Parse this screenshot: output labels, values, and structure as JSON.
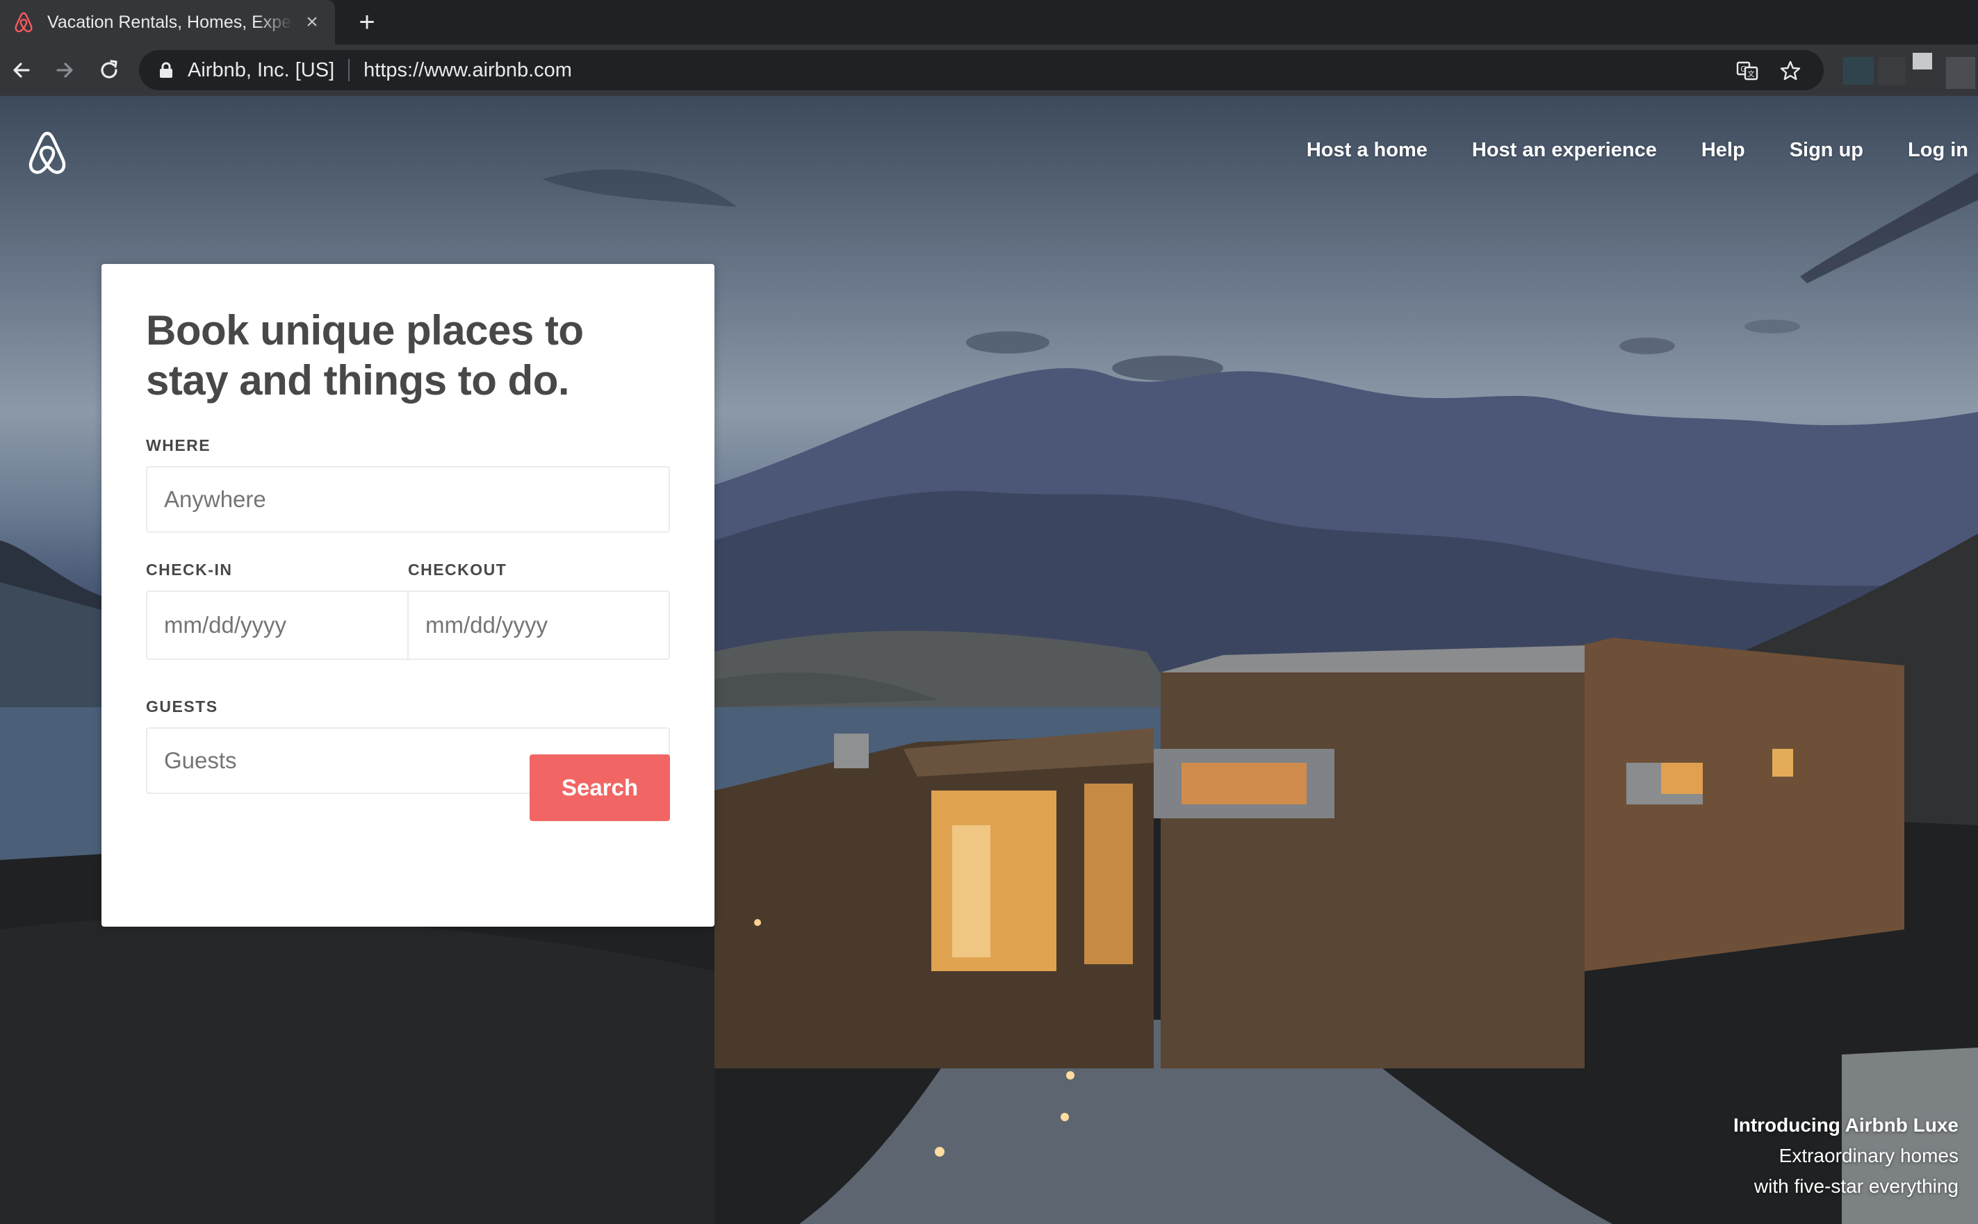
{
  "browser": {
    "tab_title": "Vacation Rentals, Homes, Experiences & Places - Airbnb",
    "close_glyph": "×",
    "new_tab_glyph": "+",
    "organization": "Airbnb, Inc. [US]",
    "url": "https://www.airbnb.com"
  },
  "nav": {
    "host_home": "Host a home",
    "host_experience": "Host an experience",
    "help": "Help",
    "sign_up": "Sign up",
    "log_in": "Log in"
  },
  "search_card": {
    "heading": "Book unique places to stay and things to do.",
    "where_label": "WHERE",
    "where_placeholder": "Anywhere",
    "checkin_label": "CHECK-IN",
    "checkout_label": "CHECKOUT",
    "date_placeholder": "mm/dd/yyyy",
    "guests_label": "GUESTS",
    "guests_value": "Guests",
    "search_button": "Search"
  },
  "promo": {
    "line1": "Introducing Airbnb Luxe",
    "line2": "Extraordinary homes",
    "line3": "with five-star everything"
  },
  "colors": {
    "brand": "#FF5A5F",
    "button": "#F16664",
    "heading_text": "#484848",
    "chrome_bg": "#35363A"
  },
  "icons": {
    "favicon": "airbnb-logo-icon",
    "back": "back-arrow-icon",
    "forward": "forward-arrow-icon",
    "reload": "reload-icon",
    "lock": "lock-icon",
    "translate": "translate-icon",
    "bookmark": "star-icon",
    "guests_dropdown": "chevron-down-icon"
  }
}
